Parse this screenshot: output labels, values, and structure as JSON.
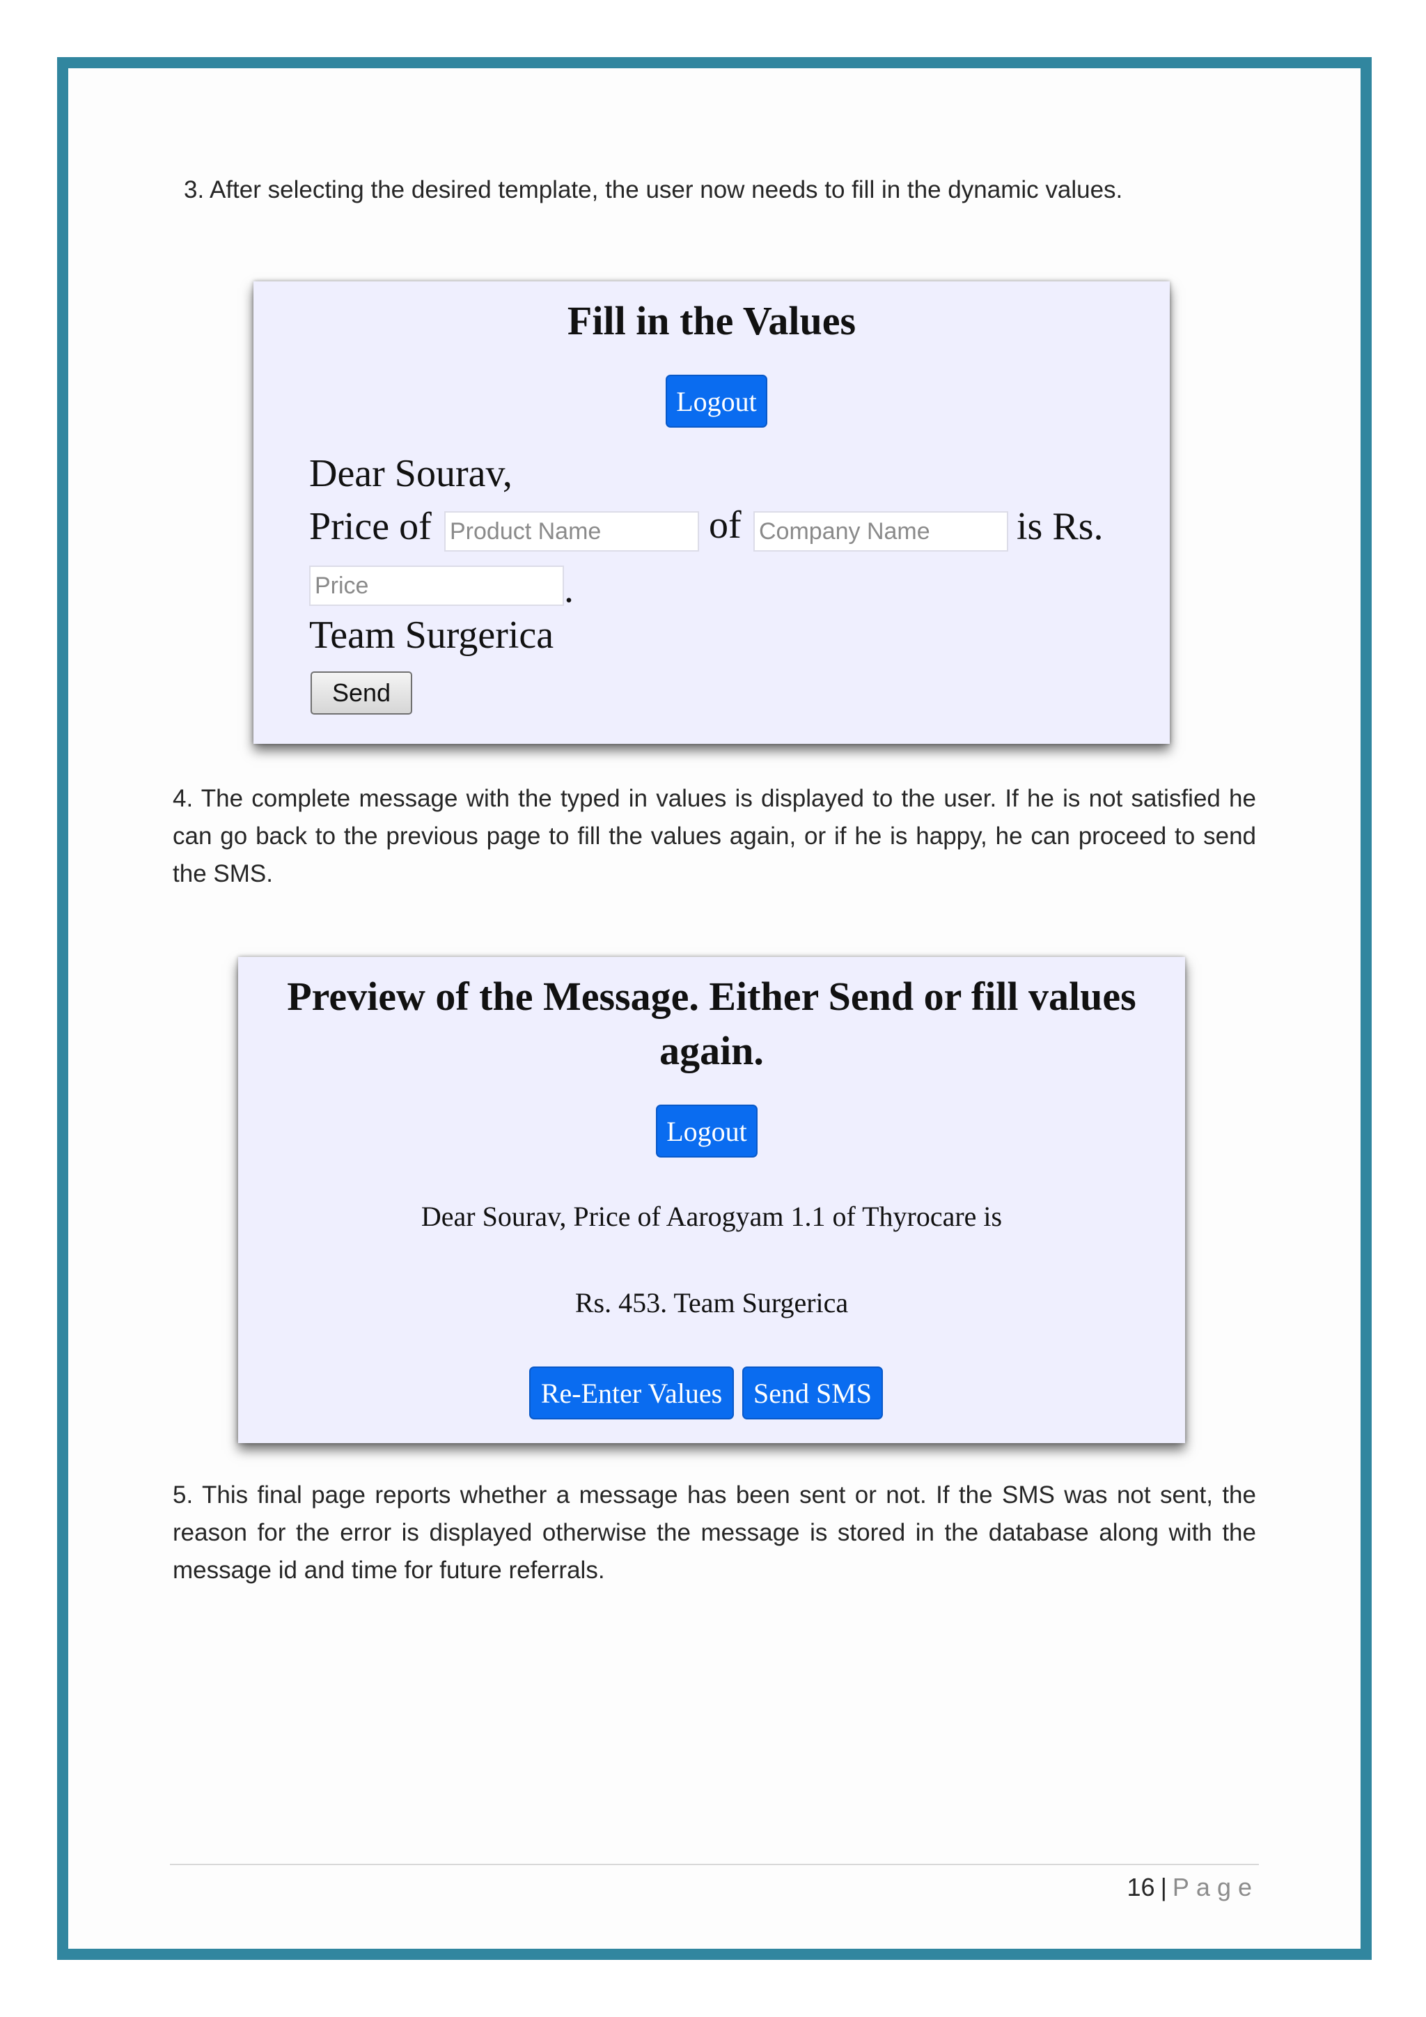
{
  "step3": "3. After selecting the desired template, the user now needs to fill in the dynamic values.",
  "fill_screen": {
    "title": "Fill in the Values",
    "logout_label": "Logout",
    "greeting": "Dear Sourav,",
    "price_of": "Price of",
    "product_placeholder": "Product Name",
    "of": "of",
    "company_placeholder": "Company Name",
    "is_rs": "is Rs.",
    "price_placeholder": "Price",
    "period": ".",
    "signoff": "Team Surgerica",
    "send_label": "Send"
  },
  "step4": "4. The complete message with the typed in values is displayed to the user. If he is not satisfied he can go back to the previous page to fill the values again, or if he is happy, he can proceed to send the SMS.",
  "preview_screen": {
    "title_line1": "Preview of the Message. Either Send or fill values",
    "title_line2": "again.",
    "logout_label": "Logout",
    "message_line1": "Dear Sourav, Price of Aarogyam 1.1 of Thyrocare is",
    "message_line2": "Rs. 453. Team Surgerica",
    "reenter_label": "Re-Enter Values",
    "send_sms_label": "Send SMS"
  },
  "step5": "5. This final page reports whether a message has been sent or not. If the SMS was not sent, the reason for the error is displayed otherwise the message is stored in the database along with the message id and time for future referrals.",
  "footer": {
    "page_number": "16",
    "separator": "|",
    "page_label": "Page"
  },
  "colors": {
    "frame": "#31869f",
    "screenshot_bg": "#efeffe",
    "button_blue": "#0a6cf0"
  }
}
